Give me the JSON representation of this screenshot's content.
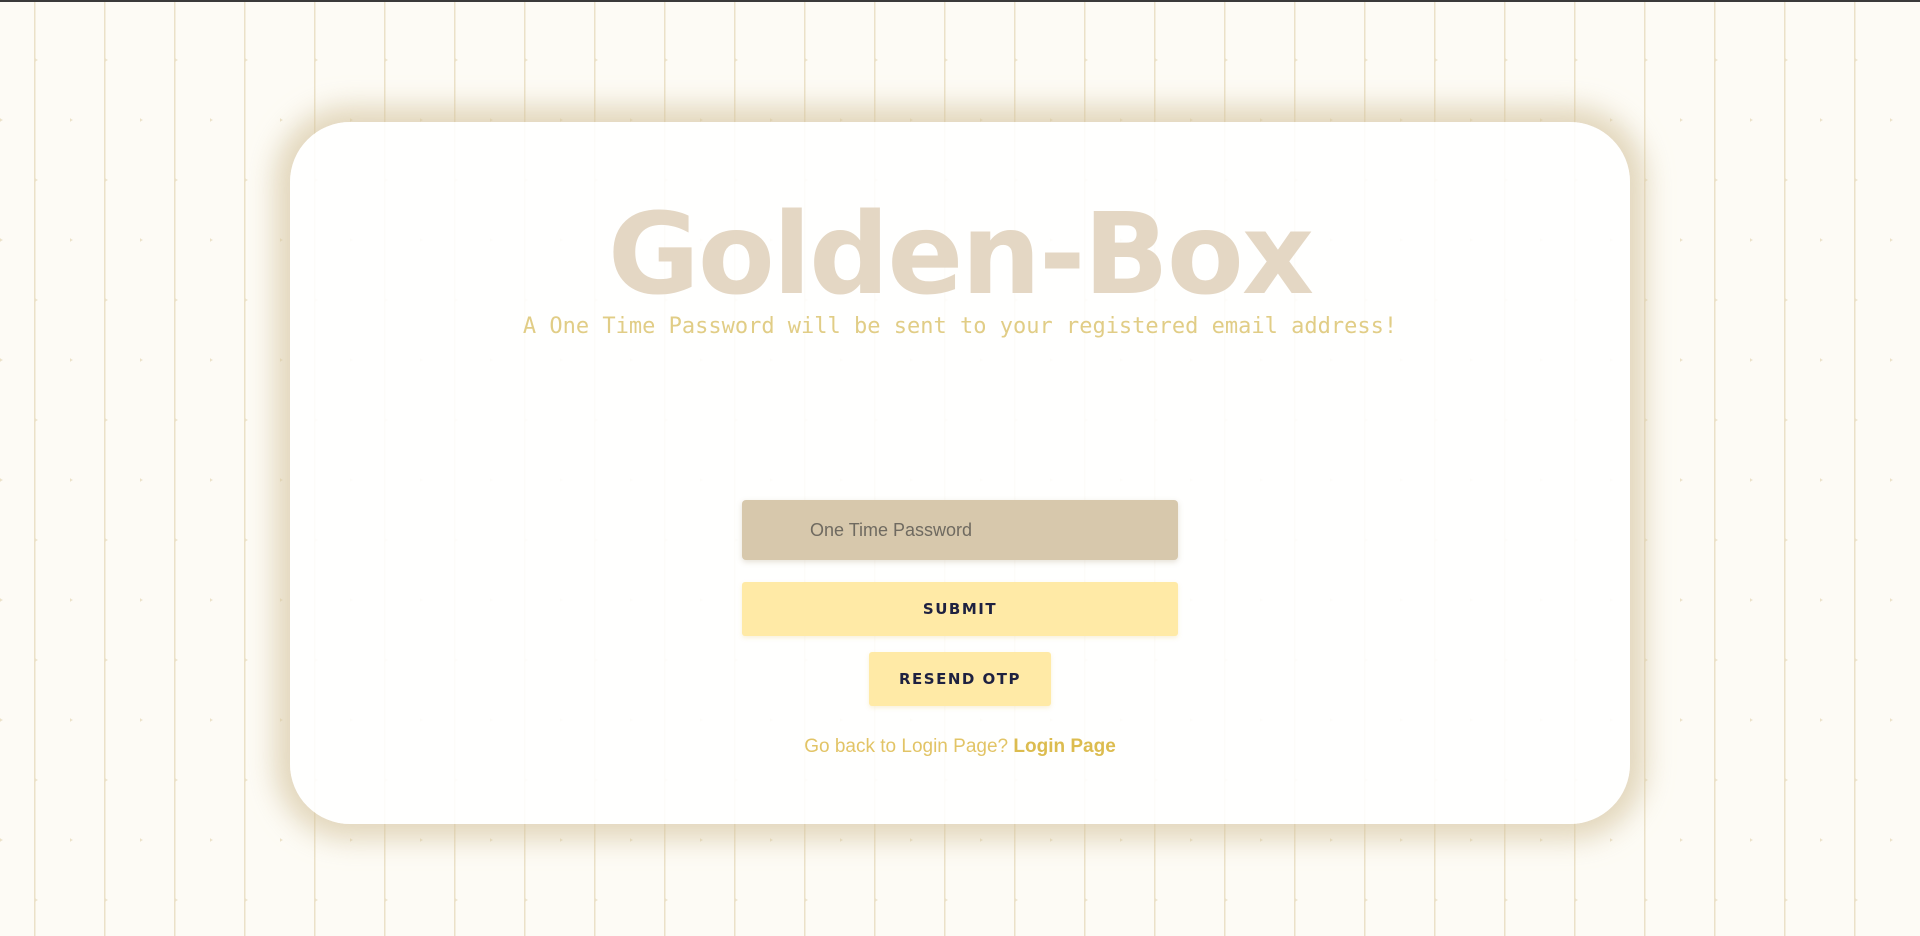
{
  "brand": {
    "title": "Golden-Box",
    "subtitle": "A One Time Password will be sent to your registered email address!"
  },
  "form": {
    "otp_placeholder": "One Time Password",
    "submit_label": "SUBMIT",
    "resend_label": "RESEND OTP"
  },
  "footer": {
    "prompt_text": "Go back to Login Page?",
    "login_link_label": "Login Page"
  },
  "colors": {
    "accent_gold": "#e2c466",
    "button_yellow": "#ffeaa6",
    "input_tan": "#d7c8ac",
    "title_beige": "#e4d7c4",
    "button_text_navy": "#1e2140"
  }
}
